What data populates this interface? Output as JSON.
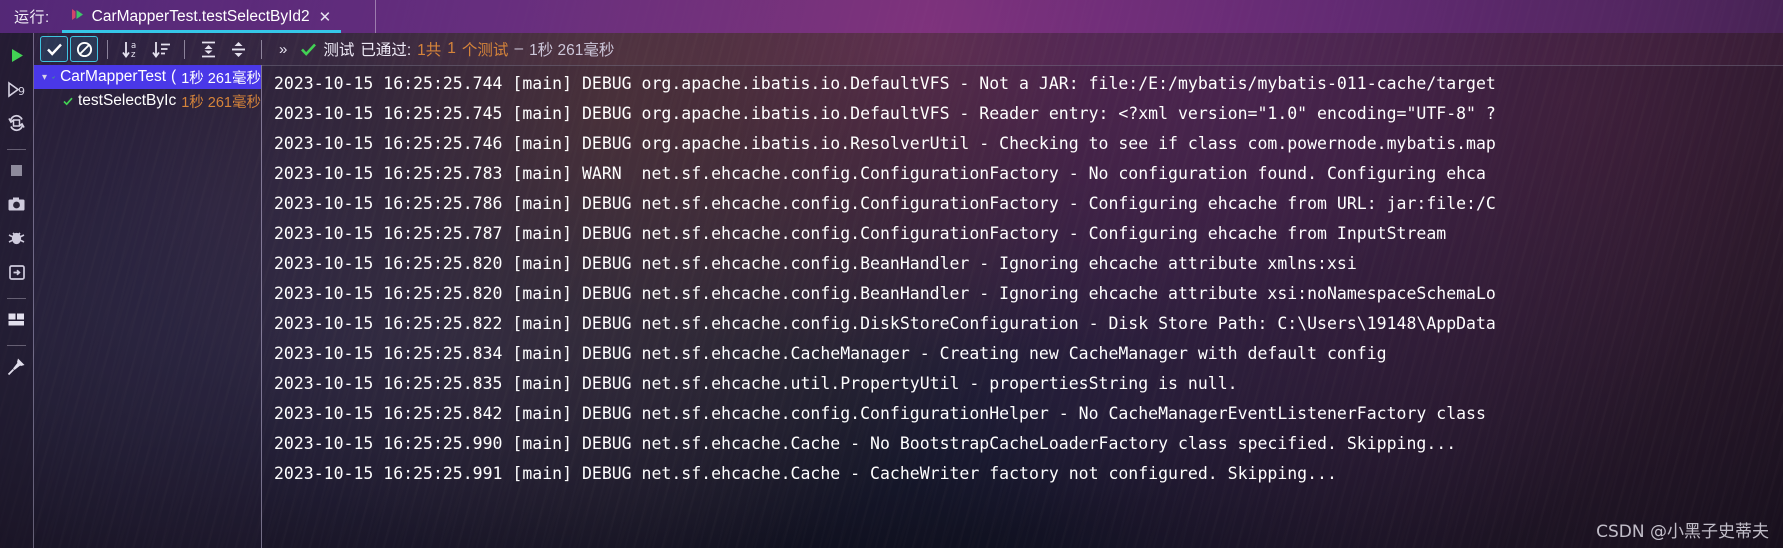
{
  "runbar": {
    "label": "运行:",
    "tab_title": "CarMapperTest.testSelectById2",
    "tab_close": "✕",
    "tab_icon": "run-config-icon",
    "accent_underline": "#36c7e8"
  },
  "sidebar": {
    "items": [
      {
        "name": "rerun-button",
        "icon": "play-icon"
      },
      {
        "name": "rerun-failed-button",
        "icon": "rerun-failed-icon"
      },
      {
        "name": "toggle-auto-test-button",
        "icon": "auto-rerun-icon"
      },
      {
        "name": "stop-button",
        "icon": "stop-square-icon"
      },
      {
        "name": "screenshot-button",
        "icon": "camera-icon"
      },
      {
        "name": "debug-button",
        "icon": "bug-icon"
      },
      {
        "name": "export-test-results-button",
        "icon": "export-icon"
      },
      {
        "name": "layout-settings-button",
        "icon": "layout-icon"
      },
      {
        "name": "pin-tab-button",
        "icon": "pin-icon"
      }
    ]
  },
  "toolbar": {
    "buttons": [
      {
        "name": "show-passed-toggle",
        "icon": "check-icon",
        "pressed": true
      },
      {
        "name": "show-ignored-toggle",
        "icon": "no-entry-icon",
        "pressed": true
      },
      {
        "name": "sort-alphabetically-button",
        "icon": "sort-alpha-icon",
        "pressed": false
      },
      {
        "name": "sort-by-duration-button",
        "icon": "sort-duration-icon",
        "pressed": false
      },
      {
        "name": "expand-all-button",
        "icon": "expand-all-icon",
        "pressed": false
      },
      {
        "name": "collapse-all-button",
        "icon": "collapse-all-icon",
        "pressed": false
      }
    ],
    "more_label": "»",
    "status": {
      "result_icon": "check-icon",
      "part1": "测试",
      "part2": "已通过:",
      "count": "1共",
      "count_orange": "1",
      "unit": "个测试",
      "dash": "–",
      "duration": "1秒 261毫秒"
    }
  },
  "tree": {
    "rows": [
      {
        "name": "CarMapperTest",
        "time": "1秒 261毫秒",
        "twisty": "▾",
        "status_icon": "check-icon",
        "selected": true,
        "indent": false,
        "prefix": "("
      },
      {
        "name": "testSelectByIc",
        "time": "1秒 261毫秒",
        "twisty": "",
        "status_icon": "check-icon",
        "selected": false,
        "indent": true,
        "prefix": ""
      }
    ]
  },
  "console": {
    "lines": [
      "2023-10-15 16:25:25.744 [main] DEBUG org.apache.ibatis.io.DefaultVFS - Not a JAR: file:/E:/mybatis/mybatis-011-cache/target",
      "2023-10-15 16:25:25.745 [main] DEBUG org.apache.ibatis.io.DefaultVFS - Reader entry: <?xml version=\"1.0\" encoding=\"UTF-8\" ?",
      "2023-10-15 16:25:25.746 [main] DEBUG org.apache.ibatis.io.ResolverUtil - Checking to see if class com.powernode.mybatis.map",
      "2023-10-15 16:25:25.783 [main] WARN  net.sf.ehcache.config.ConfigurationFactory - No configuration found. Configuring ehca",
      "2023-10-15 16:25:25.786 [main] DEBUG net.sf.ehcache.config.ConfigurationFactory - Configuring ehcache from URL: jar:file:/C",
      "2023-10-15 16:25:25.787 [main] DEBUG net.sf.ehcache.config.ConfigurationFactory - Configuring ehcache from InputStream",
      "2023-10-15 16:25:25.820 [main] DEBUG net.sf.ehcache.config.BeanHandler - Ignoring ehcache attribute xmlns:xsi",
      "2023-10-15 16:25:25.820 [main] DEBUG net.sf.ehcache.config.BeanHandler - Ignoring ehcache attribute xsi:noNamespaceSchemaLo",
      "2023-10-15 16:25:25.822 [main] DEBUG net.sf.ehcache.config.DiskStoreConfiguration - Disk Store Path: C:\\Users\\19148\\AppData",
      "2023-10-15 16:25:25.834 [main] DEBUG net.sf.ehcache.CacheManager - Creating new CacheManager with default config",
      "2023-10-15 16:25:25.835 [main] DEBUG net.sf.ehcache.util.PropertyUtil - propertiesString is null.",
      "2023-10-15 16:25:25.842 [main] DEBUG net.sf.ehcache.config.ConfigurationHelper - No CacheManagerEventListenerFactory class",
      "2023-10-15 16:25:25.990 [main] DEBUG net.sf.ehcache.Cache - No BootstrapCacheLoaderFactory class specified. Skipping...",
      "2023-10-15 16:25:25.991 [main] DEBUG net.sf.ehcache.Cache - CacheWriter factory not configured. Skipping..."
    ]
  },
  "watermark": {
    "text": "CSDN @小黑子史蒂夫"
  }
}
